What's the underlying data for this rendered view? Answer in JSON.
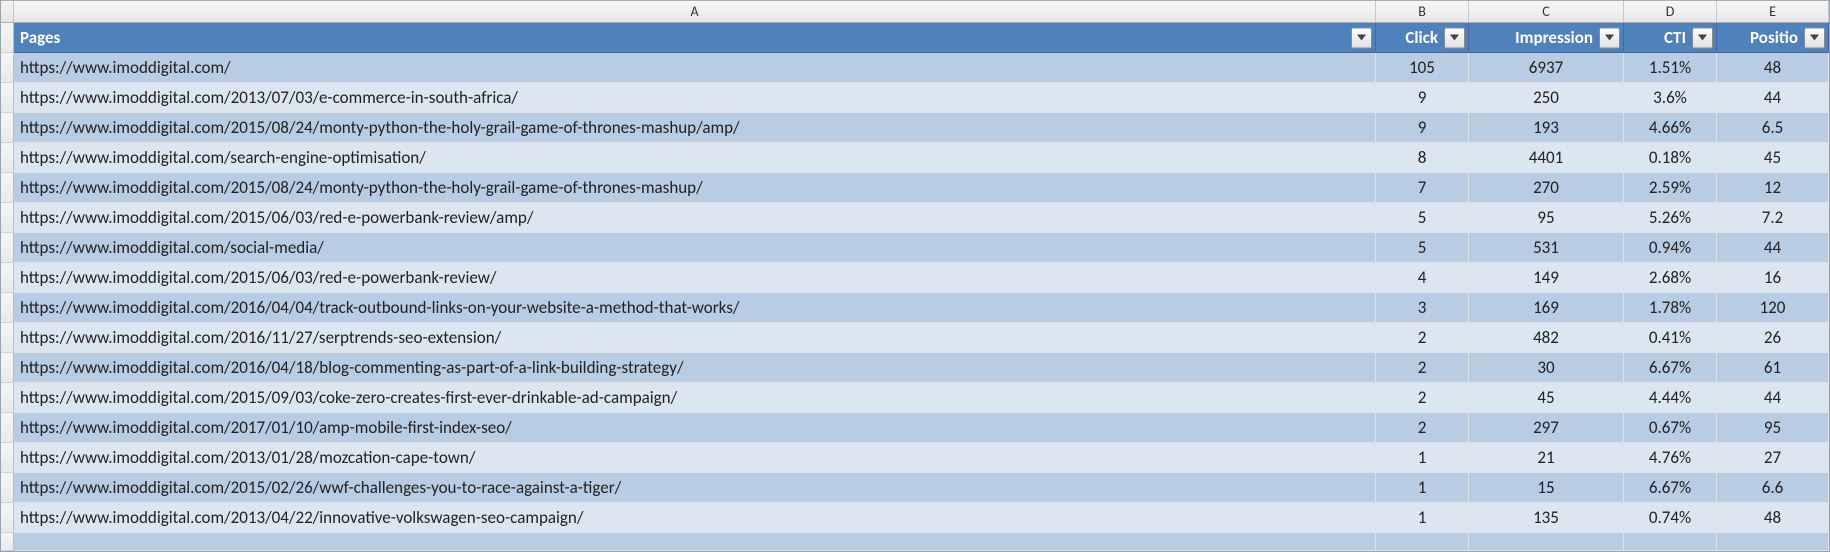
{
  "columns": {
    "A": "A",
    "B": "B",
    "C": "C",
    "D": "D",
    "E": "E"
  },
  "headers": {
    "pages": "Pages",
    "clicks": "Click",
    "impressions": "Impression",
    "ctr": "CTI",
    "position": "Positio"
  },
  "rows": [
    {
      "page": "https://www.imoddigital.com/",
      "clicks": "105",
      "impressions": "6937",
      "ctr": "1.51%",
      "position": "48"
    },
    {
      "page": "https://www.imoddigital.com/2013/07/03/e-commerce-in-south-africa/",
      "clicks": "9",
      "impressions": "250",
      "ctr": "3.6%",
      "position": "44"
    },
    {
      "page": "https://www.imoddigital.com/2015/08/24/monty-python-the-holy-grail-game-of-thrones-mashup/amp/",
      "clicks": "9",
      "impressions": "193",
      "ctr": "4.66%",
      "position": "6.5"
    },
    {
      "page": "https://www.imoddigital.com/search-engine-optimisation/",
      "clicks": "8",
      "impressions": "4401",
      "ctr": "0.18%",
      "position": "45"
    },
    {
      "page": "https://www.imoddigital.com/2015/08/24/monty-python-the-holy-grail-game-of-thrones-mashup/",
      "clicks": "7",
      "impressions": "270",
      "ctr": "2.59%",
      "position": "12"
    },
    {
      "page": "https://www.imoddigital.com/2015/06/03/red-e-powerbank-review/amp/",
      "clicks": "5",
      "impressions": "95",
      "ctr": "5.26%",
      "position": "7.2"
    },
    {
      "page": "https://www.imoddigital.com/social-media/",
      "clicks": "5",
      "impressions": "531",
      "ctr": "0.94%",
      "position": "44"
    },
    {
      "page": "https://www.imoddigital.com/2015/06/03/red-e-powerbank-review/",
      "clicks": "4",
      "impressions": "149",
      "ctr": "2.68%",
      "position": "16"
    },
    {
      "page": "https://www.imoddigital.com/2016/04/04/track-outbound-links-on-your-website-a-method-that-works/",
      "clicks": "3",
      "impressions": "169",
      "ctr": "1.78%",
      "position": "120"
    },
    {
      "page": "https://www.imoddigital.com/2016/11/27/serptrends-seo-extension/",
      "clicks": "2",
      "impressions": "482",
      "ctr": "0.41%",
      "position": "26"
    },
    {
      "page": "https://www.imoddigital.com/2016/04/18/blog-commenting-as-part-of-a-link-building-strategy/",
      "clicks": "2",
      "impressions": "30",
      "ctr": "6.67%",
      "position": "61"
    },
    {
      "page": "https://www.imoddigital.com/2015/09/03/coke-zero-creates-first-ever-drinkable-ad-campaign/",
      "clicks": "2",
      "impressions": "45",
      "ctr": "4.44%",
      "position": "44"
    },
    {
      "page": "https://www.imoddigital.com/2017/01/10/amp-mobile-first-index-seo/",
      "clicks": "2",
      "impressions": "297",
      "ctr": "0.67%",
      "position": "95"
    },
    {
      "page": "https://www.imoddigital.com/2013/01/28/mozcation-cape-town/",
      "clicks": "1",
      "impressions": "21",
      "ctr": "4.76%",
      "position": "27"
    },
    {
      "page": "https://www.imoddigital.com/2015/02/26/wwf-challenges-you-to-race-against-a-tiger/",
      "clicks": "1",
      "impressions": "15",
      "ctr": "6.67%",
      "position": "6.6"
    },
    {
      "page": "https://www.imoddigital.com/2013/04/22/innovative-volkswagen-seo-campaign/",
      "clicks": "1",
      "impressions": "135",
      "ctr": "0.74%",
      "position": "48"
    }
  ]
}
